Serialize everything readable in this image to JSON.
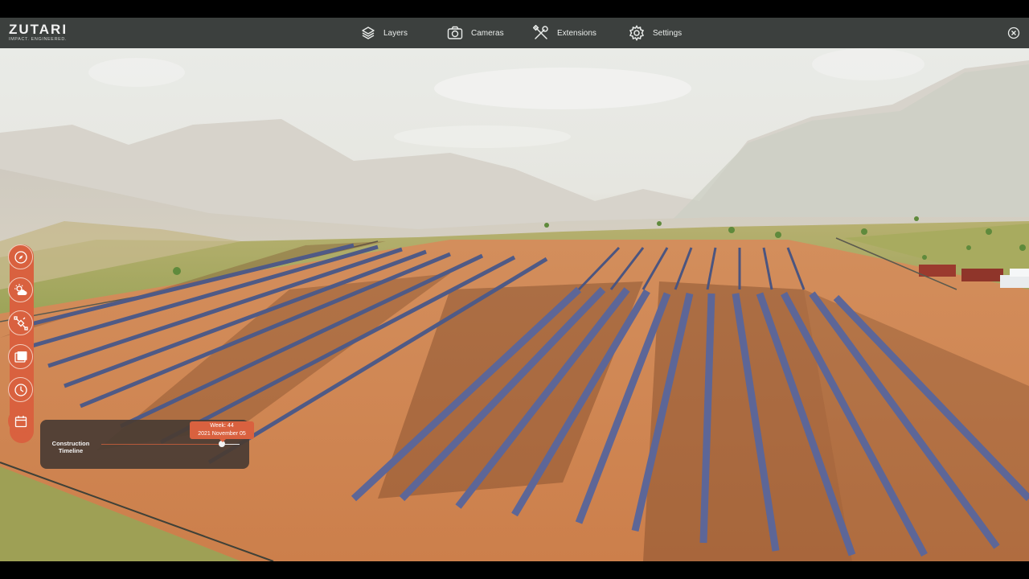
{
  "app": {
    "logo_text": "ZUTARI",
    "logo_tagline": "IMPACT. ENGINEERED."
  },
  "nav": [
    {
      "label": "Layers",
      "icon": "layers-icon"
    },
    {
      "label": "Cameras",
      "icon": "camera-icon"
    },
    {
      "label": "Extensions",
      "icon": "tools-icon"
    },
    {
      "label": "Settings",
      "icon": "gear-icon"
    }
  ],
  "side_tools": [
    {
      "icon": "compass-icon"
    },
    {
      "icon": "weather-icon"
    },
    {
      "icon": "satellite-icon"
    },
    {
      "icon": "gallery-icon"
    },
    {
      "icon": "clock-icon"
    },
    {
      "icon": "calendar-icon"
    }
  ],
  "timeline": {
    "label_line1": "Construction",
    "label_line2": "Timeline",
    "week_text": "Week: 44",
    "date_text": "2021 November 05",
    "progress": 0.88
  },
  "colors": {
    "accent": "#d9613f",
    "topbar": "#3c403e",
    "panel": "#4a3c34"
  }
}
